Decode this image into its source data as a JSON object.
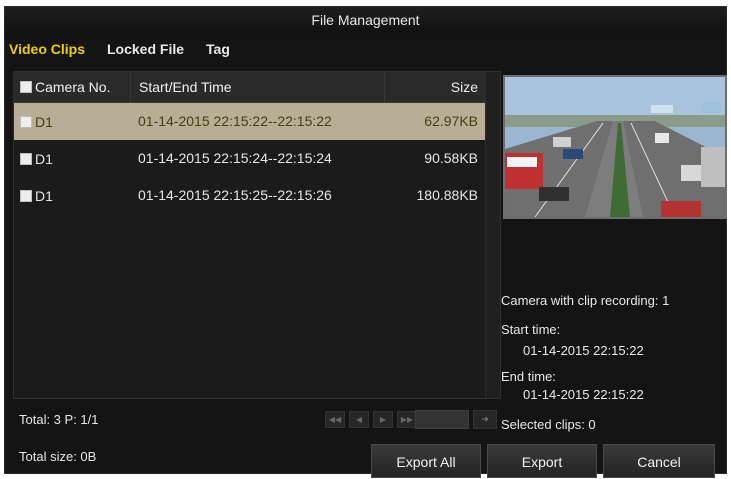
{
  "window": {
    "title": "File Management"
  },
  "tabs": [
    {
      "label": "Video Clips",
      "active": true
    },
    {
      "label": "Locked File",
      "active": false
    },
    {
      "label": "Tag",
      "active": false
    }
  ],
  "table": {
    "columns": {
      "camera": "Camera No.",
      "time": "Start/End Time",
      "size": "Size"
    },
    "rows": [
      {
        "camera": "D1",
        "time": "01-14-2015 22:15:22--22:15:22",
        "size": "62.97KB",
        "selected": true
      },
      {
        "camera": "D1",
        "time": "01-14-2015 22:15:24--22:15:24",
        "size": "90.58KB",
        "selected": false
      },
      {
        "camera": "D1",
        "time": "01-14-2015 22:15:25--22:15:26",
        "size": "180.88KB",
        "selected": false
      }
    ]
  },
  "status": {
    "total": "Total: 3  P: 1/1"
  },
  "info": {
    "camera_with_clip": "Camera with clip recording: 1",
    "start_label": "Start time:",
    "start_value": "01-14-2015 22:15:22",
    "end_label": "End time:",
    "end_value": "01-14-2015 22:15:22",
    "selected_clips": "Selected clips: 0"
  },
  "footer": {
    "total_size": "Total size: 0B",
    "export_all": "Export All",
    "export": "Export",
    "cancel": "Cancel"
  },
  "colors": {
    "active_tab": "#f0d000",
    "selected_row": "#b7ae95"
  }
}
